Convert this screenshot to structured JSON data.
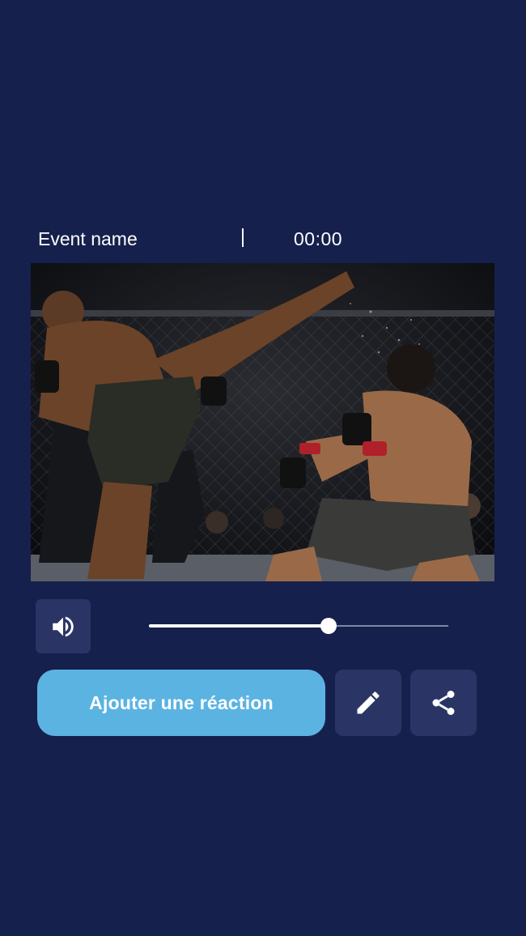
{
  "event": {
    "name": "Event name",
    "time": "00:00"
  },
  "media": {
    "image_icon": "mma-fight-photo"
  },
  "player": {
    "volume_icon": "volume-icon",
    "progress_fraction": 0.6
  },
  "actions": {
    "react_label": "Ajouter une réaction",
    "edit_icon": "pencil-icon",
    "share_icon": "share-icon"
  },
  "colors": {
    "background": "#16204d",
    "button_dark": "#2a3566",
    "accent": "#5bb3e2"
  }
}
